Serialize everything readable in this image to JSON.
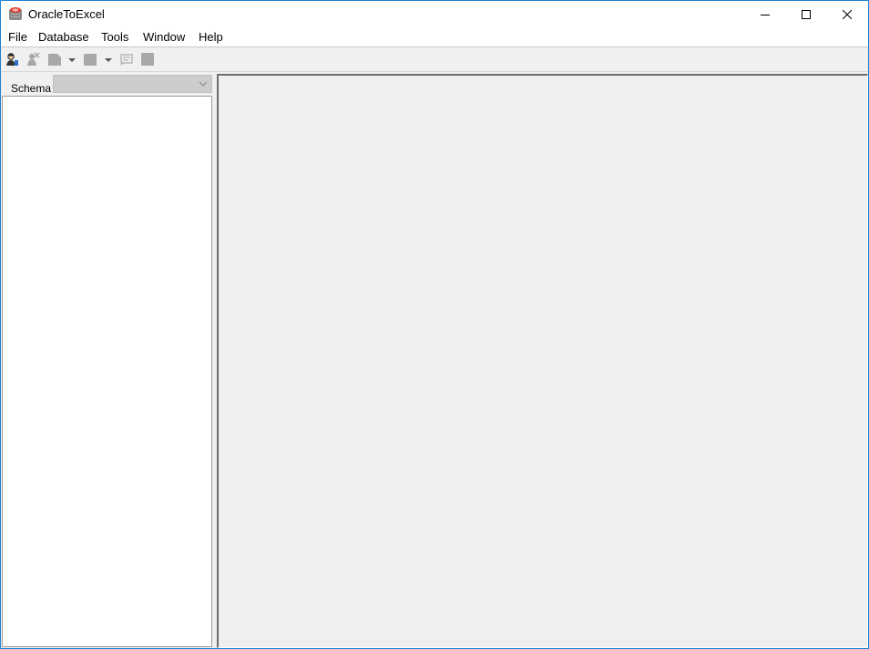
{
  "window": {
    "title": "OracleToExcel",
    "icon": "oracle-db-icon",
    "controls": [
      "minimize-icon",
      "maximize-icon",
      "close-icon"
    ],
    "accent": "#1883d7"
  },
  "menu": {
    "items": [
      "File",
      "Database",
      "Tools",
      "Window",
      "Help"
    ]
  },
  "toolbar": {
    "buttons": [
      {
        "icon": "connect-user-icon",
        "enabled": true
      },
      {
        "icon": "disconnect-icon",
        "enabled": false
      },
      {
        "icon": "export-icon",
        "enabled": false,
        "dropdown": true
      },
      {
        "icon": "table-icon",
        "enabled": false,
        "dropdown": true
      },
      {
        "icon": "sql-window-icon",
        "enabled": false
      },
      {
        "icon": "stop-icon",
        "enabled": false
      }
    ]
  },
  "left_panel": {
    "schema_label": "Schema",
    "schema_value": "",
    "tree_items": []
  },
  "colors": {
    "client_area": "#efefef",
    "disabled_icon": "#a8a8a8"
  }
}
